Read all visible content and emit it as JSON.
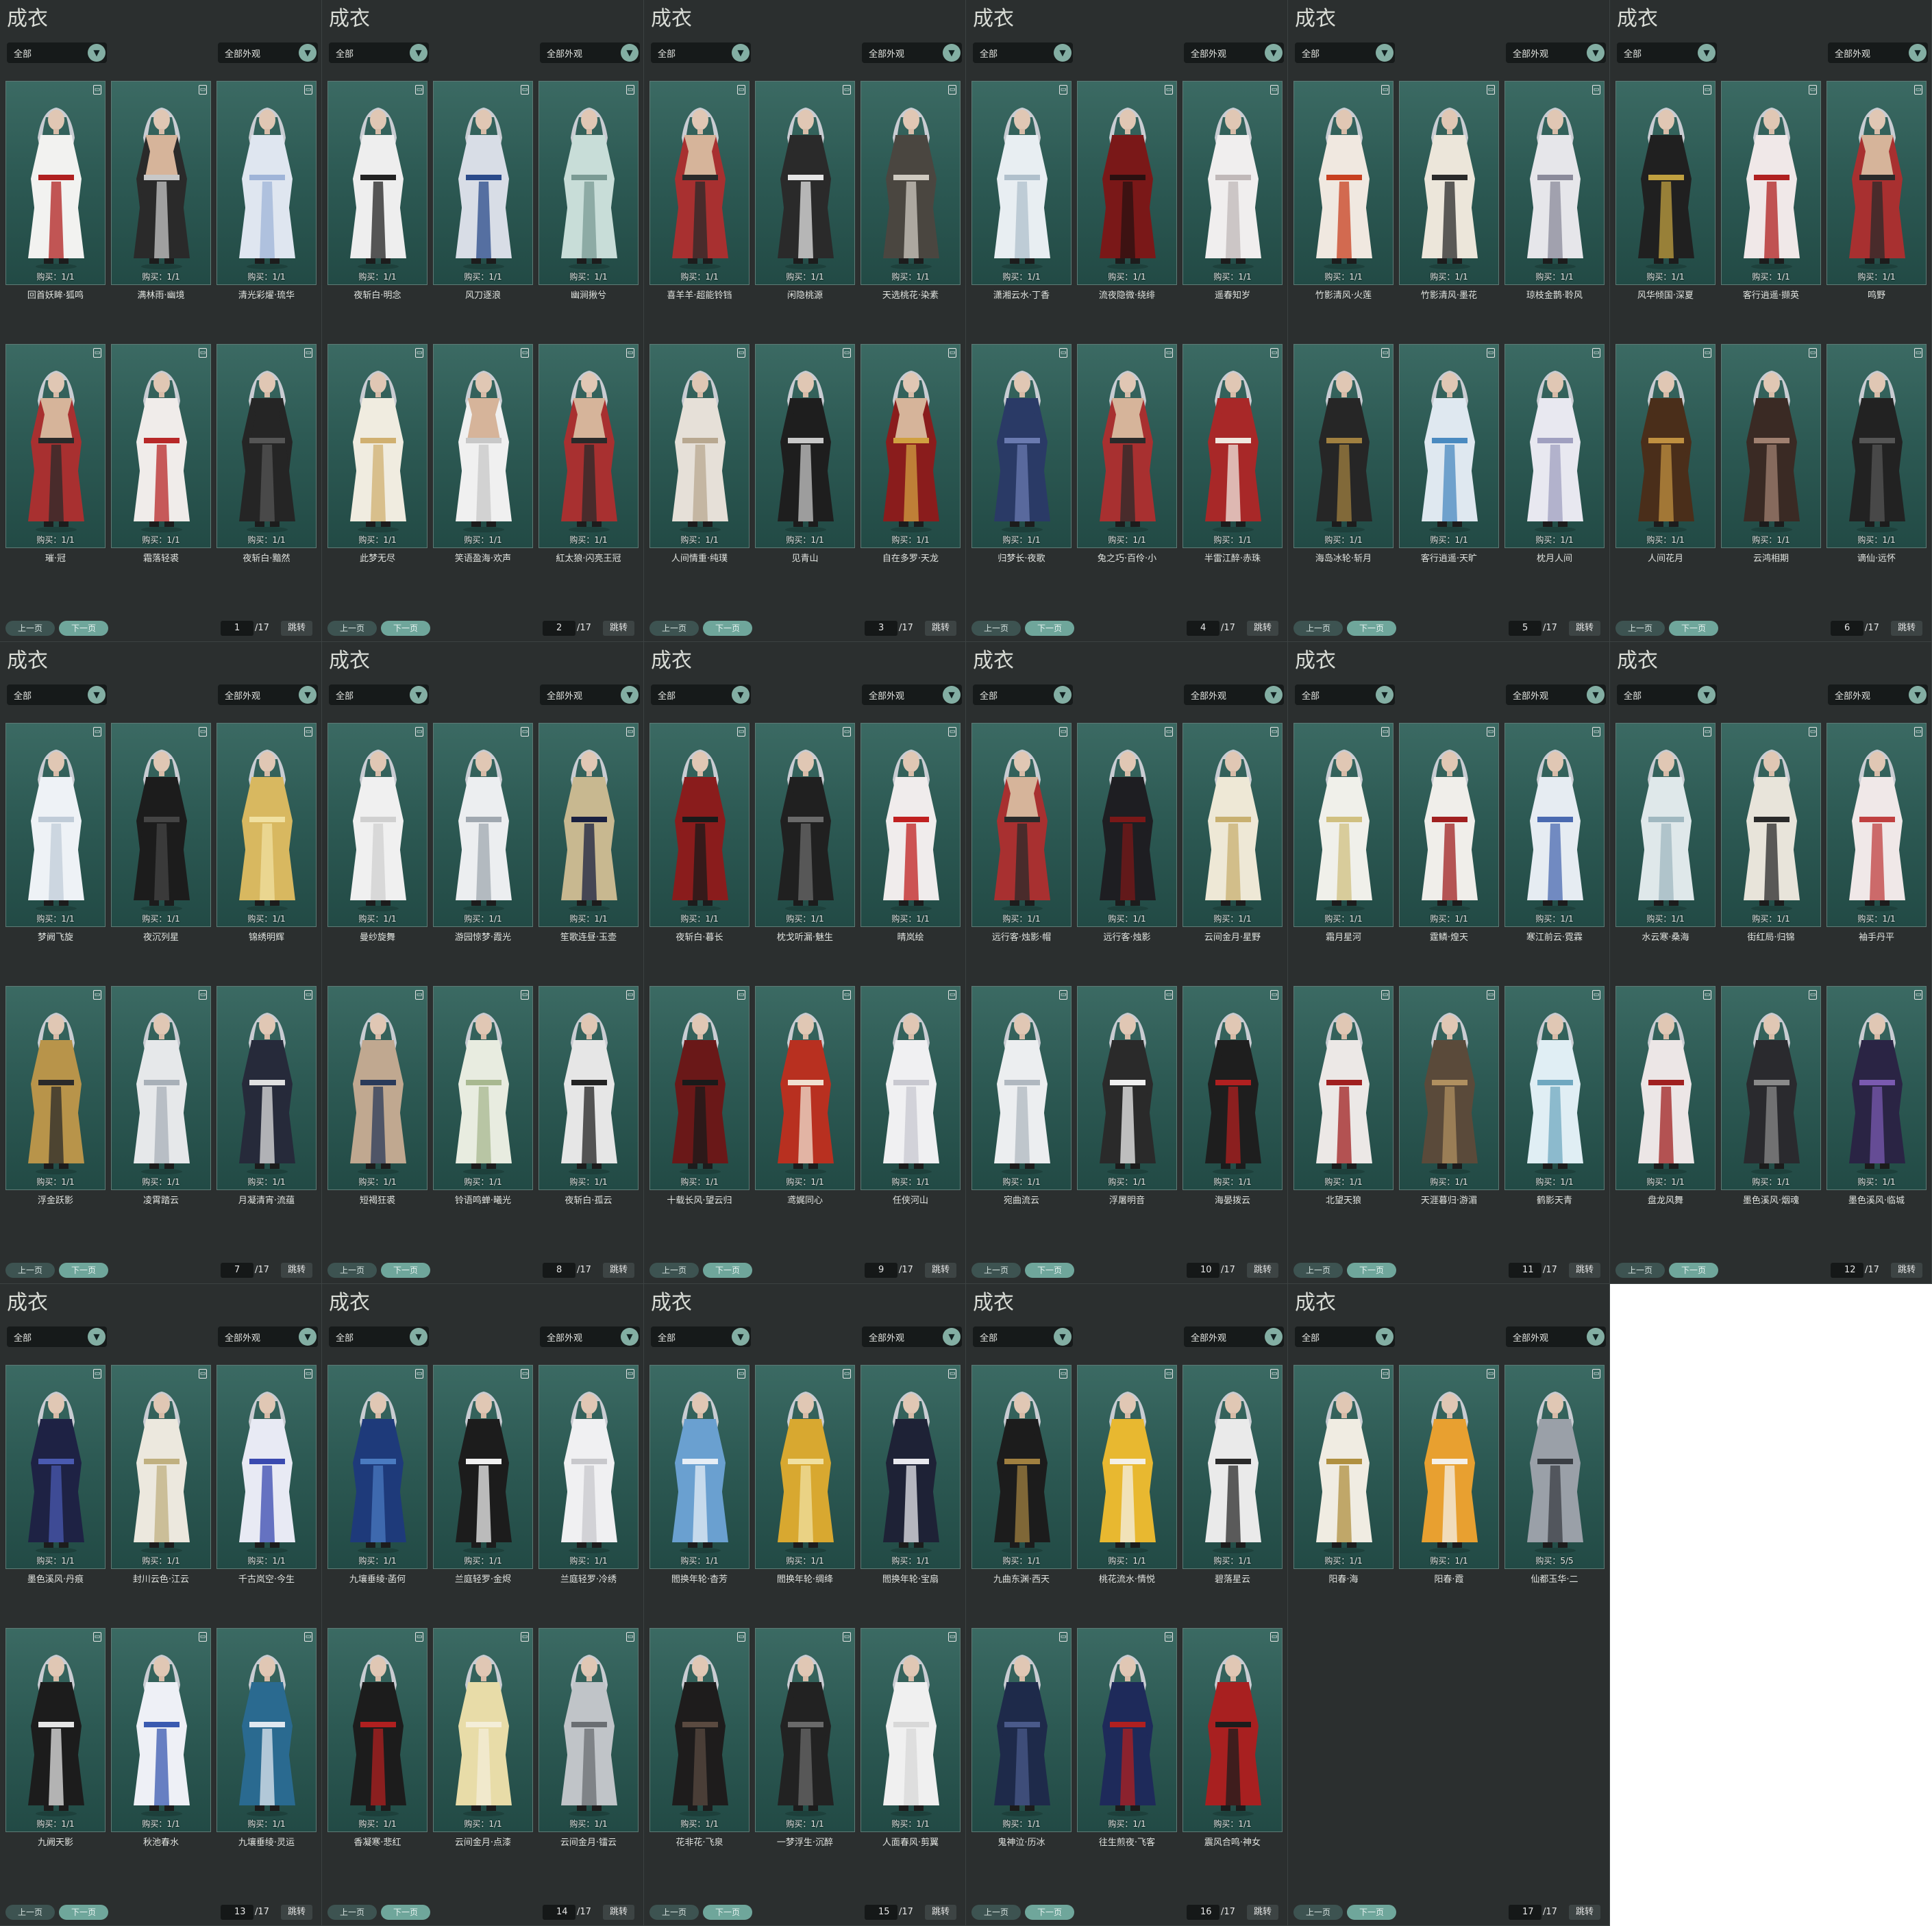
{
  "ui": {
    "title": "成衣",
    "filter_all": "全部",
    "filter_appearance": "全部外观",
    "prev": "上一页",
    "next": "下一页",
    "jump": "跳转",
    "total": "/17",
    "chevron_icon": "chevron-down-icon",
    "trash_icon": "trash-icon"
  },
  "colors": {
    "panel_bg": "#2b2f2f",
    "card_bg": "#2d5a54",
    "accent": "#6fa69b",
    "text": "#e0e3df"
  },
  "pages": [
    {
      "page": "1",
      "items": [
        {
          "name": "回首妖眸·狐鸣",
          "buy": "购买：1/1",
          "body": "#f2f2f0",
          "accent": "#b02020",
          "skin": "none"
        },
        {
          "name": "满林雨·幽境",
          "buy": "购买：1/1",
          "body": "#2a2a2a",
          "accent": "#c8c8c8",
          "skin": "bare"
        },
        {
          "name": "清光彩燿·琉华",
          "buy": "购买：1/1",
          "body": "#dfe6f0",
          "accent": "#9fb4d8",
          "skin": "none"
        },
        {
          "name": "璀·冠",
          "buy": "购买：1/1",
          "body": "#a83030",
          "accent": "#2a2a2a",
          "skin": "bare"
        },
        {
          "name": "霜落轻裘",
          "buy": "购买：1/1",
          "body": "#f0ecea",
          "accent": "#b82828",
          "skin": "none"
        },
        {
          "name": "夜斩白·黯然",
          "buy": "购买：1/1",
          "body": "#252525",
          "accent": "#555555",
          "skin": "none"
        }
      ]
    },
    {
      "page": "2",
      "items": [
        {
          "name": "夜斩白·明念",
          "buy": "购买：1/1",
          "body": "#eeeeee",
          "accent": "#222222",
          "skin": "none"
        },
        {
          "name": "风刀逐浪",
          "buy": "购买：1/1",
          "body": "#d8dde6",
          "accent": "#2a4a8a",
          "skin": "none"
        },
        {
          "name": "幽涧揪兮",
          "buy": "购买：1/1",
          "body": "#c8ddd8",
          "accent": "#7a9a94",
          "skin": "none"
        },
        {
          "name": "此梦无尽",
          "buy": "购买：1/1",
          "body": "#f0ece0",
          "accent": "#d0b070",
          "skin": "none"
        },
        {
          "name": "笑语盈海·欢声",
          "buy": "购买：1/1",
          "body": "#f0f0f0",
          "accent": "#c8c8c8",
          "skin": "bare"
        },
        {
          "name": "紅太狼·闪亮王冠",
          "buy": "购买：1/1",
          "body": "#a83030",
          "accent": "#2a2a2a",
          "skin": "bare"
        }
      ]
    },
    {
      "page": "3",
      "items": [
        {
          "name": "喜羊羊·超能铃铛",
          "buy": "购买：1/1",
          "body": "#a83030",
          "accent": "#2a2a2a",
          "skin": "bare"
        },
        {
          "name": "闲隐桃源",
          "buy": "购买：1/1",
          "body": "#2a2a2a",
          "accent": "#e6e6e6",
          "skin": "none"
        },
        {
          "name": "天选桃花·染素",
          "buy": "购买：1/1",
          "body": "#4a4640",
          "accent": "#cfcac0",
          "skin": "none"
        },
        {
          "name": "人间情重·纯璞",
          "buy": "购买：1/1",
          "body": "#e6e0d8",
          "accent": "#b8a890",
          "skin": "none"
        },
        {
          "name": "见青山",
          "buy": "购买：1/1",
          "body": "#1e1e1e",
          "accent": "#c8c8c8",
          "skin": "none"
        },
        {
          "name": "自在多罗·天龙",
          "buy": "购买：1/1",
          "body": "#8a1c1c",
          "accent": "#d0a040",
          "skin": "bare"
        }
      ]
    },
    {
      "page": "4",
      "items": [
        {
          "name": "潇湘云水·丁香",
          "buy": "购买：1/1",
          "body": "#e8eef2",
          "accent": "#b0c0cc",
          "skin": "none"
        },
        {
          "name": "流夜隐微·绕绯",
          "buy": "购买：1/1",
          "body": "#7a1818",
          "accent": "#2a1010",
          "skin": "none"
        },
        {
          "name": "遥春知岁",
          "buy": "购买：1/1",
          "body": "#f0eeee",
          "accent": "#c0b8b8",
          "skin": "none"
        },
        {
          "name": "归梦长·夜歌",
          "buy": "购买：1/1",
          "body": "#2a3a66",
          "accent": "#6a7ab0",
          "skin": "none"
        },
        {
          "name": "兔之巧·百伶·小",
          "buy": "购买：1/1",
          "body": "#a83030",
          "accent": "#2a2a2a",
          "skin": "bare"
        },
        {
          "name": "半雷江醉·赤珠",
          "buy": "购买：1/1",
          "body": "#a82828",
          "accent": "#f0e8e0",
          "skin": "none"
        }
      ]
    },
    {
      "page": "5",
      "items": [
        {
          "name": "竹影清风·火莲",
          "buy": "购买：1/1",
          "body": "#f0e8e0",
          "accent": "#c84020",
          "skin": "none"
        },
        {
          "name": "竹影清风·墨花",
          "buy": "购买：1/1",
          "body": "#ece6da",
          "accent": "#2a2a2a",
          "skin": "none"
        },
        {
          "name": "琼枝金鹊·聆风",
          "buy": "购买：1/1",
          "body": "#e6e6ea",
          "accent": "#8a8a9a",
          "skin": "none"
        },
        {
          "name": "海岛冰轮·斩月",
          "buy": "购买：1/1",
          "body": "#262626",
          "accent": "#a08040",
          "skin": "none"
        },
        {
          "name": "客行逍遥·天旷",
          "buy": "购买：1/1",
          "body": "#dfe8f0",
          "accent": "#4a8ac0",
          "skin": "none"
        },
        {
          "name": "枕月人间",
          "buy": "购买：1/1",
          "body": "#e8e8f0",
          "accent": "#a0a0c0",
          "skin": "none"
        }
      ]
    },
    {
      "page": "6",
      "items": [
        {
          "name": "风华倾国·深夏",
          "buy": "购买：1/1",
          "body": "#202020",
          "accent": "#c0a040",
          "skin": "none"
        },
        {
          "name": "客行逍遥·撷英",
          "buy": "购买：1/1",
          "body": "#f0e8e8",
          "accent": "#b02020",
          "skin": "none"
        },
        {
          "name": "鸣野",
          "buy": "购买：1/1",
          "body": "#a83030",
          "accent": "#2a2a2a",
          "skin": "bare"
        },
        {
          "name": "人间花月",
          "buy": "购买：1/1",
          "body": "#4a2e1a",
          "accent": "#c09040",
          "skin": "none"
        },
        {
          "name": "云鸿相期",
          "buy": "购买：1/1",
          "body": "#3a2a24",
          "accent": "#a08070",
          "skin": "none"
        },
        {
          "name": "谪仙·远怀",
          "buy": "购买：1/1",
          "body": "#222222",
          "accent": "#555555",
          "skin": "none"
        }
      ]
    },
    {
      "page": "7",
      "items": [
        {
          "name": "梦阙飞旋",
          "buy": "购买：1/1",
          "body": "#eef2f6",
          "accent": "#c0ccd8",
          "skin": "none"
        },
        {
          "name": "夜沉列星",
          "buy": "购买：1/1",
          "body": "#1c1c1c",
          "accent": "#444444",
          "skin": "none"
        },
        {
          "name": "锦绣明辉",
          "buy": "购买：1/1",
          "body": "#d8b860",
          "accent": "#f0e0a0",
          "skin": "none"
        },
        {
          "name": "浮金跃影",
          "buy": "购买：1/1",
          "body": "#b8944a",
          "accent": "#2a2a2a",
          "skin": "none"
        },
        {
          "name": "凌霄踏云",
          "buy": "购买：1/1",
          "body": "#e6e8ea",
          "accent": "#a8b0b8",
          "skin": "none"
        },
        {
          "name": "月凝清宵·流蕴",
          "buy": "购买：1/1",
          "body": "#262a3a",
          "accent": "#e0e0e0",
          "skin": "none"
        }
      ]
    },
    {
      "page": "8",
      "items": [
        {
          "name": "曼纱旋舞",
          "buy": "购买：1/1",
          "body": "#f0f0f0",
          "accent": "#d0d0d0",
          "skin": "none"
        },
        {
          "name": "游园惊梦·霞光",
          "buy": "购买：1/1",
          "body": "#eceef0",
          "accent": "#a0a8b0",
          "skin": "none"
        },
        {
          "name": "笙歌连昼·玉壶",
          "buy": "购买：1/1",
          "body": "#c8b890",
          "accent": "#1a2040",
          "skin": "none"
        },
        {
          "name": "短褐狂裘",
          "buy": "购买：1/1",
          "body": "#c0a890",
          "accent": "#2a3a5a",
          "skin": "none"
        },
        {
          "name": "铃语鸣蝉·曦光",
          "buy": "购买：1/1",
          "body": "#e8ece0",
          "accent": "#a8b890",
          "skin": "none"
        },
        {
          "name": "夜斩白·孤云",
          "buy": "购买：1/1",
          "body": "#e6e6e6",
          "accent": "#222222",
          "skin": "none"
        }
      ]
    },
    {
      "page": "9",
      "items": [
        {
          "name": "夜斩白·暮长",
          "buy": "购买：1/1",
          "body": "#8a1c1c",
          "accent": "#1a1a1a",
          "skin": "none"
        },
        {
          "name": "枕戈听漏·魅生",
          "buy": "购买：1/1",
          "body": "#202020",
          "accent": "#6a6a6a",
          "skin": "none"
        },
        {
          "name": "晴岚绘",
          "buy": "购买：1/1",
          "body": "#f0ecec",
          "accent": "#c02020",
          "skin": "none"
        },
        {
          "name": "十载长风·望云归",
          "buy": "购买：1/1",
          "body": "#6a1818",
          "accent": "#1a1a1a",
          "skin": "none"
        },
        {
          "name": "鸢娓同心",
          "buy": "购买：1/1",
          "body": "#b83020",
          "accent": "#f0e0d0",
          "skin": "none"
        },
        {
          "name": "任侠河山",
          "buy": "购买：1/1",
          "body": "#f0f0f2",
          "accent": "#c8c8d0",
          "skin": "none"
        }
      ]
    },
    {
      "page": "10",
      "items": [
        {
          "name": "远行客·烛影·帽",
          "buy": "购买：1/1",
          "body": "#a83030",
          "accent": "#2a2a2a",
          "skin": "bare"
        },
        {
          "name": "远行客·烛影",
          "buy": "购买：1/1",
          "body": "#1e1e22",
          "accent": "#7a1818",
          "skin": "none"
        },
        {
          "name": "云间金月·星野",
          "buy": "购买：1/1",
          "body": "#eee8d6",
          "accent": "#c8b070",
          "skin": "none"
        },
        {
          "name": "宛曲流云",
          "buy": "购买：1/1",
          "body": "#eceef0",
          "accent": "#b0b8c0",
          "skin": "none"
        },
        {
          "name": "浮屠明音",
          "buy": "购买：1/1",
          "body": "#2a2a2a",
          "accent": "#f0f0f0",
          "skin": "none"
        },
        {
          "name": "海晏拨云",
          "buy": "购买：1/1",
          "body": "#1e1e1e",
          "accent": "#b02020",
          "skin": "none"
        }
      ]
    },
    {
      "page": "11",
      "items": [
        {
          "name": "霜月星河",
          "buy": "购买：1/1",
          "body": "#f0f0ea",
          "accent": "#d0c080",
          "skin": "none"
        },
        {
          "name": "霆鳞·煌天",
          "buy": "购买：1/1",
          "body": "#f0eeea",
          "accent": "#a02020",
          "skin": "none"
        },
        {
          "name": "寒江前云·霓霖",
          "buy": "购买：1/1",
          "body": "#e6ecf2",
          "accent": "#4a6ab0",
          "skin": "none"
        },
        {
          "name": "北望天狼",
          "buy": "购买：1/1",
          "body": "#ece8e6",
          "accent": "#a02020",
          "skin": "none"
        },
        {
          "name": "天涯暮归·游湄",
          "buy": "购买：1/1",
          "body": "#5a4a3a",
          "accent": "#b09060",
          "skin": "none"
        },
        {
          "name": "鹤影天青",
          "buy": "购买：1/1",
          "body": "#e0eef4",
          "accent": "#70a8c0",
          "skin": "none"
        }
      ]
    },
    {
      "page": "12",
      "items": [
        {
          "name": "水云寒·桑海",
          "buy": "购买：1/1",
          "body": "#dfe8ea",
          "accent": "#a0b8c0",
          "skin": "none"
        },
        {
          "name": "街红局·归锦",
          "buy": "购买：1/1",
          "body": "#e8e4da",
          "accent": "#2a2a2a",
          "skin": "none"
        },
        {
          "name": "袖手丹平",
          "buy": "购买：1/1",
          "body": "#f0e8e8",
          "accent": "#c04040",
          "skin": "none"
        },
        {
          "name": "盘龙风舞",
          "buy": "购买：1/1",
          "body": "#ece6e6",
          "accent": "#a02020",
          "skin": "none"
        },
        {
          "name": "墨色溪风·烟魂",
          "buy": "购买：1/1",
          "body": "#2a2a2e",
          "accent": "#8a8a8a",
          "skin": "none"
        },
        {
          "name": "墨色溪风·临城",
          "buy": "购买：1/1",
          "body": "#2a2444",
          "accent": "#7a5ab0",
          "skin": "none"
        }
      ]
    },
    {
      "page": "13",
      "items": [
        {
          "name": "墨色溪风·丹痕",
          "buy": "购买：1/1",
          "body": "#1e2244",
          "accent": "#4a5ab0",
          "skin": "none"
        },
        {
          "name": "封川云色·江云",
          "buy": "购买：1/1",
          "body": "#ece8de",
          "accent": "#c0b080",
          "skin": "none"
        },
        {
          "name": "千古岚空·今生",
          "buy": "购买：1/1",
          "body": "#e8eaf4",
          "accent": "#3a4ab0",
          "skin": "none"
        },
        {
          "name": "九阙天影",
          "buy": "购买：1/1",
          "body": "#1c1c1c",
          "accent": "#e6e6e6",
          "skin": "none"
        },
        {
          "name": "秋池春水",
          "buy": "购买：1/1",
          "body": "#eef0f6",
          "accent": "#3a5ab0",
          "skin": "none"
        },
        {
          "name": "九壤垂绫·灵运",
          "buy": "购买：1/1",
          "body": "#2a6a90",
          "accent": "#e0e8f0",
          "skin": "none"
        }
      ]
    },
    {
      "page": "14",
      "items": [
        {
          "name": "九壤垂绫·菡何",
          "buy": "购买：1/1",
          "body": "#1e3a7a",
          "accent": "#4a7ac0",
          "skin": "none"
        },
        {
          "name": "兰庭轻罗·金烬",
          "buy": "购买：1/1",
          "body": "#1c1c1c",
          "accent": "#f0f0f0",
          "skin": "none"
        },
        {
          "name": "兰庭轻罗·冷绣",
          "buy": "购买：1/1",
          "body": "#f0f0f2",
          "accent": "#c8c8cc",
          "skin": "none"
        },
        {
          "name": "香凝寒·悲红",
          "buy": "购买：1/1",
          "body": "#1c1c1c",
          "accent": "#b02020",
          "skin": "none"
        },
        {
          "name": "云间金月·点漆",
          "buy": "购买：1/1",
          "body": "#e8dca8",
          "accent": "#f4eed8",
          "skin": "none"
        },
        {
          "name": "云间金月·镭云",
          "buy": "购买：1/1",
          "body": "#c0c4c8",
          "accent": "#6a6e72",
          "skin": "none"
        }
      ]
    },
    {
      "page": "15",
      "items": [
        {
          "name": "閻换年轮·杳芳",
          "buy": "购买：1/1",
          "body": "#6aa0d0",
          "accent": "#e6eef6",
          "skin": "none"
        },
        {
          "name": "閻换年轮·绸绛",
          "buy": "购买：1/1",
          "body": "#d8a830",
          "accent": "#f0e0a0",
          "skin": "none"
        },
        {
          "name": "閻换年轮·宝扇",
          "buy": "购买：1/1",
          "body": "#1e2236",
          "accent": "#e8e8ee",
          "skin": "none"
        },
        {
          "name": "花非花·飞泉",
          "buy": "购买：1/1",
          "body": "#1e1c1c",
          "accent": "#5a4a40",
          "skin": "none"
        },
        {
          "name": "一梦浮生·沉醉",
          "buy": "购买：1/1",
          "body": "#222222",
          "accent": "#6a6a6a",
          "skin": "none"
        },
        {
          "name": "人面春风·剪翼",
          "buy": "购买：1/1",
          "body": "#f0f0f0",
          "accent": "#d8d8d8",
          "skin": "none"
        }
      ]
    },
    {
      "page": "16",
      "items": [
        {
          "name": "九曲东渊·西天",
          "buy": "购买：1/1",
          "body": "#1c1c1c",
          "accent": "#a08040",
          "skin": "none"
        },
        {
          "name": "桃花流水·情悦",
          "buy": "购买：1/1",
          "body": "#e8b830",
          "accent": "#f4f0e6",
          "skin": "none"
        },
        {
          "name": "碧落星云",
          "buy": "购买：1/1",
          "body": "#eaeaea",
          "accent": "#2a2a2a",
          "skin": "none"
        },
        {
          "name": "鬼神泣·历冰",
          "buy": "购买：1/1",
          "body": "#1e2a4a",
          "accent": "#4a5a8a",
          "skin": "none"
        },
        {
          "name": "往生煎夜·飞客",
          "buy": "购买：1/1",
          "body": "#1e2a5a",
          "accent": "#b02020",
          "skin": "none"
        },
        {
          "name": "震风合鸣·神女",
          "buy": "购买：1/1",
          "body": "#a82020",
          "accent": "#1c1c1c",
          "skin": "none"
        }
      ]
    },
    {
      "page": "17",
      "items": [
        {
          "name": "阳春·海",
          "buy": "购买：1/1",
          "body": "#f0ece2",
          "accent": "#b09040",
          "skin": "none"
        },
        {
          "name": "阳春·霞",
          "buy": "购买：1/1",
          "body": "#e8a030",
          "accent": "#f4f0e8",
          "skin": "none"
        },
        {
          "name": "仙都玉华·二",
          "buy": "购买：5/5",
          "body": "#9aa0a8",
          "accent": "#3a3e44",
          "skin": "none"
        }
      ]
    }
  ]
}
